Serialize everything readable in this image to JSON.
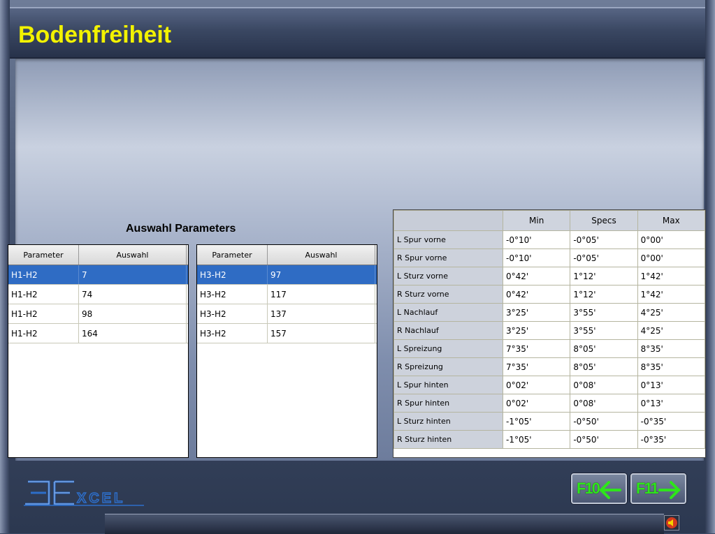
{
  "title": "Bodenfreiheit",
  "section_title": "Auswahl Parameters",
  "left_list": {
    "headers": [
      "Parameter",
      "Auswahl"
    ],
    "rows": [
      {
        "param": "H1-H2",
        "value": "7"
      },
      {
        "param": "H1-H2",
        "value": "74"
      },
      {
        "param": "H1-H2",
        "value": "98"
      },
      {
        "param": "H1-H2",
        "value": "164"
      }
    ],
    "selected_index": 0
  },
  "right_list": {
    "headers": [
      "Parameter",
      "Auswahl"
    ],
    "rows": [
      {
        "param": "H3-H2",
        "value": "97"
      },
      {
        "param": "H3-H2",
        "value": "117"
      },
      {
        "param": "H3-H2",
        "value": "137"
      },
      {
        "param": "H3-H2",
        "value": "157"
      }
    ],
    "selected_index": 0
  },
  "spec_table": {
    "headers": [
      "",
      "Min",
      "Specs",
      "Max"
    ],
    "rows": [
      {
        "name": "L Spur vorne",
        "min": "-0°10'",
        "specs": "-0°05'",
        "max": "0°00'"
      },
      {
        "name": "R Spur vorne",
        "min": "-0°10'",
        "specs": "-0°05'",
        "max": "0°00'"
      },
      {
        "name": "L Sturz vorne",
        "min": "0°42'",
        "specs": "1°12'",
        "max": "1°42'"
      },
      {
        "name": "R Sturz vorne",
        "min": "0°42'",
        "specs": "1°12'",
        "max": "1°42'"
      },
      {
        "name": "L Nachlauf",
        "min": "3°25'",
        "specs": "3°55'",
        "max": "4°25'"
      },
      {
        "name": "R Nachlauf",
        "min": "3°25'",
        "specs": "3°55'",
        "max": "4°25'"
      },
      {
        "name": "L Spreizung",
        "min": "7°35'",
        "specs": "8°05'",
        "max": "8°35'"
      },
      {
        "name": "R Spreizung",
        "min": "7°35'",
        "specs": "8°05'",
        "max": "8°35'"
      },
      {
        "name": "L Spur hinten",
        "min": "0°02'",
        "specs": "0°08'",
        "max": "0°13'"
      },
      {
        "name": "R Spur hinten",
        "min": "0°02'",
        "specs": "0°08'",
        "max": "0°13'"
      },
      {
        "name": "L Sturz hinten",
        "min": "-1°05'",
        "specs": "-0°50'",
        "max": "-0°35'"
      },
      {
        "name": "R Sturz hinten",
        "min": "-1°05'",
        "specs": "-0°50'",
        "max": "-0°35'"
      }
    ]
  },
  "logo": {
    "text": "XCEL"
  },
  "buttons": {
    "back": {
      "label": "F10",
      "icon": "arrow-left-icon"
    },
    "next": {
      "label": "F11",
      "icon": "arrow-right-icon"
    }
  },
  "colors": {
    "title": "#f2f200",
    "selection": "#2f6cc4",
    "button_text": "#2ee61a"
  },
  "speaker_icon": "speaker-icon"
}
